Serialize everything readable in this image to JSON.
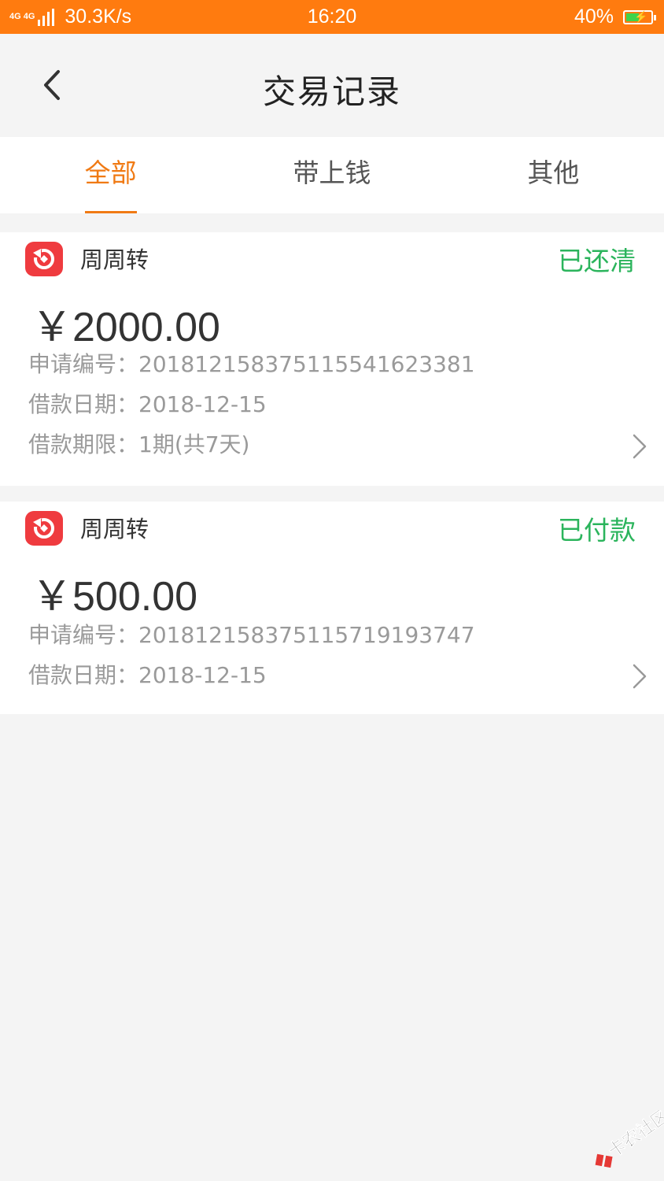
{
  "status_bar": {
    "network": "4G 4G",
    "speed": "30.3K/s",
    "time": "16:20",
    "battery": "40%"
  },
  "header": {
    "title": "交易记录",
    "back_icon": "chevron-left-icon"
  },
  "tabs": [
    {
      "label": "全部",
      "active": true
    },
    {
      "label": "带上钱",
      "active": false
    },
    {
      "label": "其他",
      "active": false
    }
  ],
  "records": [
    {
      "app_name": "周周转",
      "status": "已还清",
      "amount": "￥2000.00",
      "lines": [
        "申请编号：20181215837511554162338​1",
        "借款日期：2018-12-15",
        "借款期限：1期(共7天)"
      ]
    },
    {
      "app_name": "周周转",
      "status": "已付款",
      "amount": "￥500.00",
      "lines": [
        "申请编号：20181215837511571919374​7",
        "借款日期：2018-12-15"
      ]
    }
  ],
  "watermark": "卡农社区",
  "colors": {
    "status_bar": "#ff7b0f",
    "accent": "#f07a14",
    "status_green": "#2bb45c",
    "app_icon": "#ef3b3f"
  }
}
